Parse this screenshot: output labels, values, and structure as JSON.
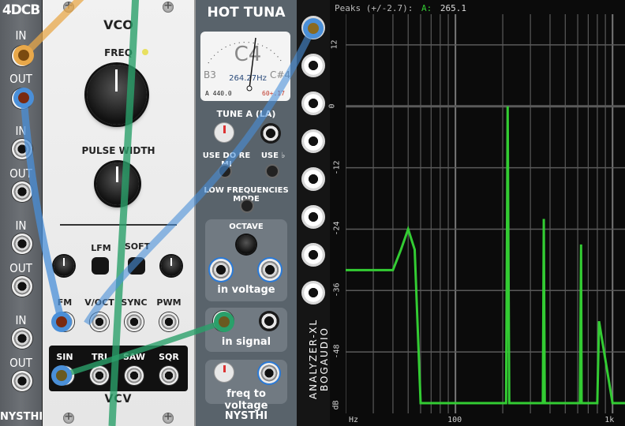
{
  "modules": {
    "m4dcb": {
      "title": "4DCB",
      "labels": [
        "IN",
        "OUT",
        "IN",
        "OUT",
        "IN",
        "OUT",
        "IN",
        "OUT"
      ],
      "brand": "NYSTHI"
    },
    "vco": {
      "title": "VCO",
      "freq": "FREQ",
      "pw": "PULSE WIDTH",
      "lfm": "LFM",
      "soft": "SOFT",
      "inputs": [
        "FM",
        "V/OCT",
        "SYNC",
        "PWM"
      ],
      "outputs": [
        "SIN",
        "TRI",
        "SAW",
        "SQR"
      ],
      "brand": "VCV"
    },
    "tuna": {
      "title": "HOT TUNA",
      "note": "C4",
      "freq": "264.27Hz",
      "prev": "B3",
      "next": "C#4",
      "a": "A 440.0",
      "cents": "60+.17",
      "tune": "TUNE A (LA)",
      "doremi": "USE DO RE MI",
      "useb": "USE ♭",
      "lowfreq": "LOW FREQUENCIES MODE",
      "octave": "OCTAVE",
      "inv": "in voltage",
      "insig": "in signal",
      "f2v": "freq to voltage",
      "brand": "NYSTHI"
    },
    "analyzer": {
      "peaks_title": "Peaks (+/-2.7):",
      "ch": "A:",
      "peak_val": "265.1",
      "vlabel1": "ANALYZER-XL",
      "vlabel2": "BOGAUDIO"
    }
  },
  "colors": {
    "peak": "#33cc33",
    "wire_blue": "#4a8fd8",
    "wire_green": "#2aa06a",
    "wire_orange": "#e8a84a"
  },
  "chart_data": {
    "type": "line",
    "title": "",
    "ylabel": "dB",
    "y_ticks": [
      "12",
      "0",
      "-12",
      "-24",
      "-36",
      "-48"
    ],
    "x_ticks": [
      "Hz",
      "100",
      "1k"
    ],
    "ylim": [
      -60,
      18
    ],
    "xlim": [
      20,
      1200
    ],
    "xscale": "log",
    "series": [
      {
        "x": [
          20,
          40,
          45,
          50,
          55,
          60,
          200,
          210,
          215,
          220,
          225,
          350,
          360,
          365,
          370,
          375,
          500,
          510,
          515,
          520,
          525,
          620,
          630,
          635,
          640,
          645,
          800,
          820,
          1000,
          1200
        ],
        "y": [
          -32,
          -32,
          -28,
          -24,
          -28,
          -58,
          -58,
          -58,
          0,
          -58,
          -58,
          -58,
          -58,
          -22,
          -58,
          -58,
          -58,
          -58,
          -58,
          -58,
          -58,
          -58,
          -27,
          -58,
          -58,
          -58,
          -58,
          -42,
          -58,
          -58
        ]
      }
    ]
  }
}
